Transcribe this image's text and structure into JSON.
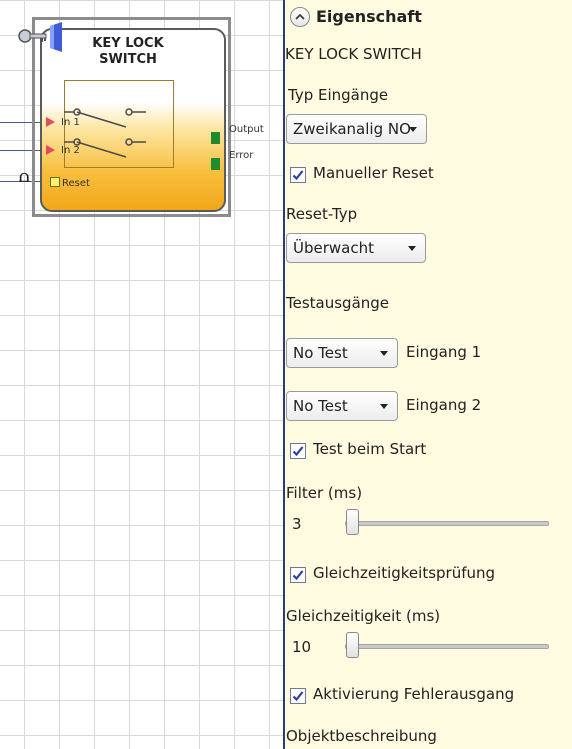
{
  "canvas": {
    "block": {
      "title": "KEY LOCK\nSWITCH",
      "inputs": [
        "In 1",
        "In 2",
        "Reset"
      ],
      "outputs": [
        "Output",
        "Error"
      ]
    },
    "pulse_symbol": "⩍"
  },
  "panel": {
    "header_title": "Eigenschaft",
    "object_name": "KEY LOCK SWITCH",
    "input_type": {
      "label": "Typ Eingänge",
      "value": "Zweikanalig NO"
    },
    "manual_reset": {
      "label": "Manueller Reset",
      "checked": true
    },
    "reset_type": {
      "label": "Reset-Typ",
      "value": "Überwacht"
    },
    "test_outputs": {
      "label": "Testausgänge",
      "rows": [
        {
          "value": "No Test",
          "label": "Eingang 1"
        },
        {
          "value": "No Test",
          "label": "Eingang 2"
        }
      ]
    },
    "test_at_start": {
      "label": "Test beim Start",
      "checked": true
    },
    "filter": {
      "label": "Filter (ms)",
      "value": "3",
      "slider_fraction": 0.0
    },
    "simultaneity_check": {
      "label": "Gleichzeitigkeitsprüfung",
      "checked": true
    },
    "simultaneity": {
      "label": "Gleichzeitigkeit (ms)",
      "value": "10",
      "slider_fraction": 0.0
    },
    "error_output": {
      "label": "Aktivierung Fehlerausgang",
      "checked": true
    },
    "object_description": {
      "label": "Objektbeschreibung"
    }
  },
  "colors": {
    "panel_bg": "#fffbe0",
    "separator": "#2d3a7a",
    "block_gradient_bottom": "#f2a71a",
    "input_arrow": "#e34a5a",
    "output_pin": "#1f8a2e",
    "checkbox_check": "#2b3f9e"
  },
  "icons": [
    "key-lock-icon",
    "collapse-chevron-up-icon",
    "dropdown-caret-icon",
    "checkmark-icon",
    "pulse-icon"
  ]
}
